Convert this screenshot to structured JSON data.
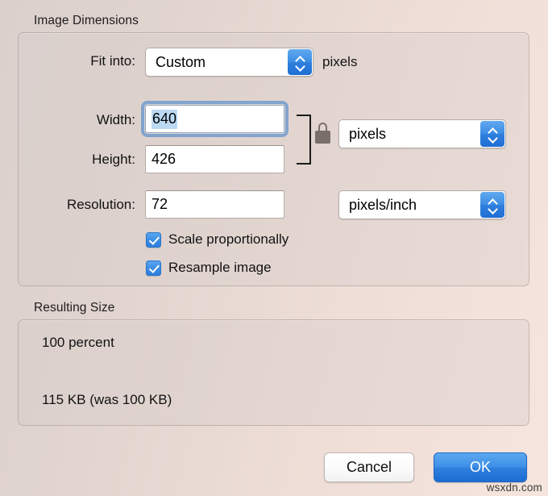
{
  "dialog": {
    "sections": {
      "image_dimensions": {
        "label": "Image Dimensions",
        "fit_into": {
          "label": "Fit into:",
          "value": "Custom",
          "unit_suffix": "pixels"
        },
        "width": {
          "label": "Width:",
          "value": "640",
          "selected": true
        },
        "height": {
          "label": "Height:",
          "value": "426"
        },
        "resolution": {
          "label": "Resolution:",
          "value": "72"
        },
        "size_unit": {
          "value": "pixels"
        },
        "resolution_unit": {
          "value": "pixels/inch"
        },
        "link_icon": "lock-closed-icon",
        "checkboxes": [
          {
            "label": "Scale proportionally",
            "checked": true
          },
          {
            "label": "Resample image",
            "checked": true
          }
        ]
      },
      "resulting_size": {
        "label": "Resulting Size",
        "percent_line": "100 percent",
        "size_line": "115 KB (was 100 KB)"
      }
    },
    "buttons": {
      "cancel": "Cancel",
      "ok": "OK"
    },
    "colors": {
      "accent_blue": "#3d8fe7",
      "selection_blue": "#bcd9f3",
      "lock_gray": "#7b6f69"
    }
  },
  "watermark": "wsxdn.com"
}
